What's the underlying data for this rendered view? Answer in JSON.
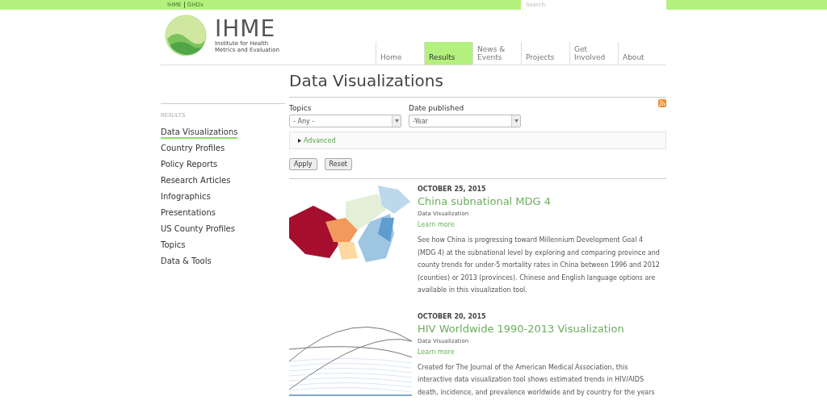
{
  "top_bar": {
    "links": [
      "IHME",
      "GHDx"
    ],
    "search": {
      "placeholder": "Search"
    }
  },
  "logo": {
    "name": "IHME",
    "subtitle": "Institute for Health Metrics and Evaluation"
  },
  "nav": [
    {
      "label": "Home",
      "selected": false
    },
    {
      "label": "Results",
      "selected": true
    },
    {
      "label": "News & Events",
      "selected": false
    },
    {
      "label": "Projects",
      "selected": false
    },
    {
      "label": "Get Involved",
      "selected": false
    },
    {
      "label": "About",
      "selected": false
    }
  ],
  "page_title": "Data Visualizations",
  "sidebar": {
    "heading": "RESULTS",
    "items": [
      {
        "label": "Data Visualizations",
        "selected": true
      },
      {
        "label": "Country Profiles",
        "selected": false
      },
      {
        "label": "Policy Reports",
        "selected": false
      },
      {
        "label": "Research Articles",
        "selected": false
      },
      {
        "label": "Infographics",
        "selected": false
      },
      {
        "label": "Presentations",
        "selected": false
      },
      {
        "label": "US County Profiles",
        "selected": false
      },
      {
        "label": "Topics",
        "selected": false
      },
      {
        "label": "Data & Tools",
        "selected": false
      }
    ]
  },
  "filters": [
    {
      "label": "Topics",
      "value": "- Any -"
    },
    {
      "label": "Date published",
      "value": "-Year"
    }
  ],
  "advanced": {
    "label": "Advanced",
    "expanded": false
  },
  "buttons": [
    "Apply",
    "Reset"
  ],
  "results": [
    {
      "kind": "map",
      "date": "OCTOBER 25, 2015",
      "title": "China subnational MDG 4",
      "type": "Data Visualization",
      "link": "Learn more",
      "description": "See how China is progressing toward Millennium Development Goal 4 (MDG 4) at the subnational level by exploring and comparing province and county trends for under-5 mortality rates in China between 1996 and 2012 (counties) or 2013 (provinces). Chinese and English language options are available in this visualization tool."
    },
    {
      "kind": "lines",
      "date": "OCTOBER 20, 2015",
      "title": "HIV Worldwide 1990-2013 Visualization",
      "type": "Data Visualization",
      "link": "Learn more",
      "description": "Created for The Journal of the American Medical Association, this interactive data visualization tool shows estimated trends in HIV/AIDS death, incidence, and prevalence worldwide and by country for the years"
    }
  ]
}
